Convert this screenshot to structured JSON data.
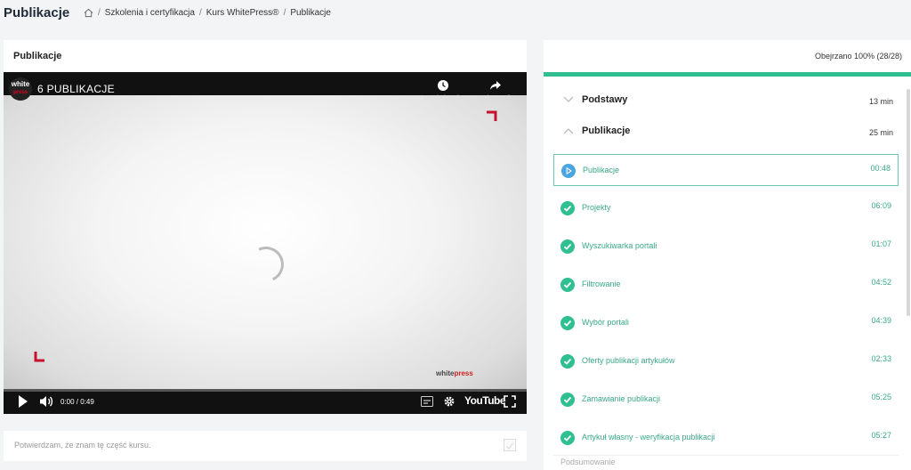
{
  "header": {
    "page_title": "Publikacje",
    "breadcrumb": [
      "Szkolenia i certyfikacja",
      "Kurs WhitePress®",
      "Publikacje"
    ]
  },
  "video_card": {
    "title": "Publikacje",
    "video_title": "6 PUBLIKACJE",
    "channel_logo": {
      "top": "white",
      "bottom": "press"
    },
    "watch_later_label": "Do obejrzenia",
    "share_label": "Udostępnij",
    "time": "0:00 / 0:49",
    "youtube_label": "YouTube",
    "watermark": {
      "main": "white",
      "accent": "press"
    }
  },
  "confirm": {
    "text": "Potwierdzam, że znam tę część kursu."
  },
  "course_panel": {
    "watched_text": "Obejrzano 100% (28/28)",
    "watched_progress": 1.0,
    "sections": [
      {
        "label": "Podstawy",
        "duration": "13 min",
        "expanded": false
      },
      {
        "label": "Publikacje",
        "duration": "25 min",
        "expanded": true
      }
    ],
    "lessons": [
      {
        "label": "Publikacje",
        "duration": "00:48",
        "status": "playing"
      },
      {
        "label": "Projekty",
        "duration": "06:09",
        "status": "done"
      },
      {
        "label": "Wyszukiwarka portali",
        "duration": "01:07",
        "status": "done"
      },
      {
        "label": "Filtrowanie",
        "duration": "04:52",
        "status": "done"
      },
      {
        "label": "Wybór portali",
        "duration": "04:39",
        "status": "done"
      },
      {
        "label": "Oferty publikacji artykułów",
        "duration": "02:33",
        "status": "done"
      },
      {
        "label": "Zamawianie publikacji",
        "duration": "05:25",
        "status": "done"
      },
      {
        "label": "Artykuł własny - weryfikacja publikacji",
        "duration": "05:27",
        "status": "done"
      }
    ],
    "next_item": "Podsumowanie"
  },
  "colors": {
    "accent_green": "#2fbf91",
    "play_blue": "#4aa6e0",
    "brand_red": "#c8102e"
  }
}
